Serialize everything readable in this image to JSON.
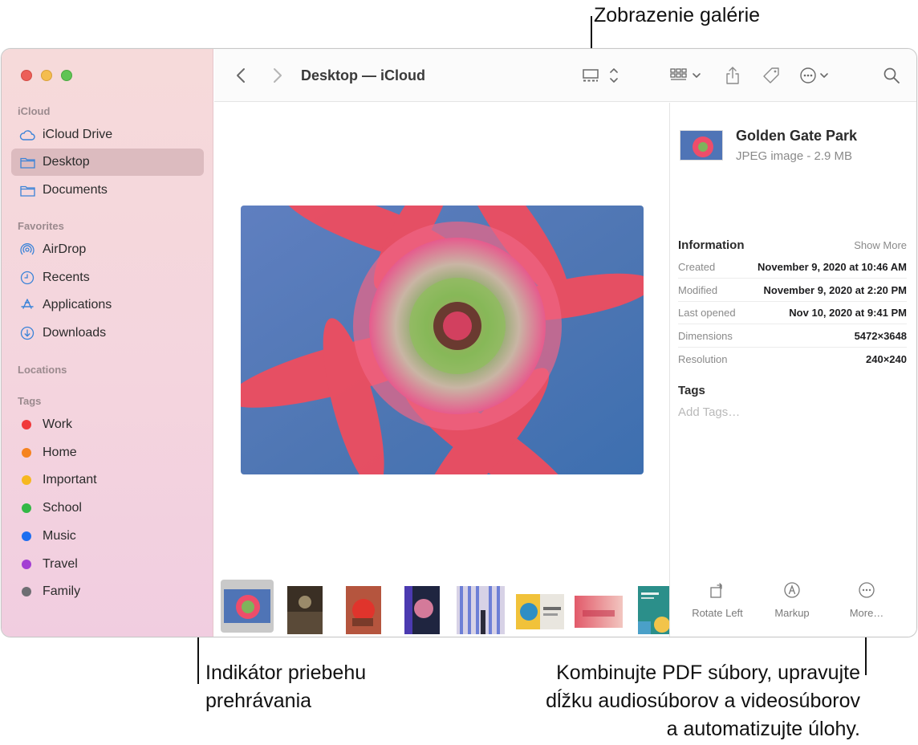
{
  "callouts": {
    "gallery_view": "Zobrazenie galérie",
    "scrubber_1": "Indikátor priebehu",
    "scrubber_2": "prehrávania",
    "more_1": "Kombinujte PDF súbory, upravujte",
    "more_2": "dĺžku audiosúborov a videosúborov",
    "more_3": "a automatizujte úlohy."
  },
  "sidebar": {
    "sections": {
      "icloud": "iCloud",
      "favorites": "Favorites",
      "locations": "Locations",
      "tags": "Tags"
    },
    "icloud_items": [
      "iCloud Drive",
      "Desktop",
      "Documents"
    ],
    "favorite_items": [
      "AirDrop",
      "Recents",
      "Applications",
      "Downloads"
    ],
    "tags": [
      {
        "label": "Work",
        "color": "#f0393a"
      },
      {
        "label": "Home",
        "color": "#f5831f"
      },
      {
        "label": "Important",
        "color": "#f6b820"
      },
      {
        "label": "School",
        "color": "#33b845"
      },
      {
        "label": "Music",
        "color": "#1e6ef0"
      },
      {
        "label": "Travel",
        "color": "#a33ed3"
      },
      {
        "label": "Family",
        "color": "#6e6e73"
      }
    ]
  },
  "toolbar": {
    "title": "Desktop — iCloud",
    "icons": [
      "back-icon",
      "forward-icon",
      "gallery-view-icon",
      "group-icon",
      "share-icon",
      "tag-icon",
      "more-icon",
      "search-icon"
    ]
  },
  "inspector": {
    "name": "Golden Gate Park",
    "kind": "JPEG image - 2.9 MB",
    "information_heading": "Information",
    "show_more": "Show More",
    "rows": [
      {
        "k": "Created",
        "v": "November 9, 2020 at 10:46 AM"
      },
      {
        "k": "Modified",
        "v": "November 9, 2020 at 2:20 PM"
      },
      {
        "k": "Last opened",
        "v": "Nov 10, 2020 at 9:41 PM"
      },
      {
        "k": "Dimensions",
        "v": "5472×3648"
      },
      {
        "k": "Resolution",
        "v": "240×240"
      }
    ],
    "tags_heading": "Tags",
    "add_tags": "Add Tags…",
    "actions": [
      "Rotate Left",
      "Markup",
      "More…"
    ]
  },
  "colors": {
    "accent": "#2e7cf6",
    "sidebar_bg": "#f5d6dc"
  }
}
